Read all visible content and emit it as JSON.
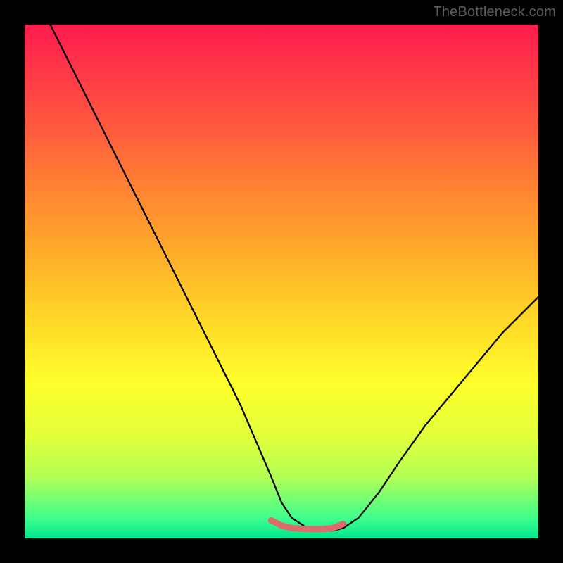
{
  "watermark": "TheBottleneck.com",
  "chart_data": {
    "type": "line",
    "title": "",
    "xlabel": "",
    "ylabel": "",
    "xlim": [
      0,
      100
    ],
    "ylim": [
      0,
      100
    ],
    "grid": false,
    "legend": false,
    "notes": "Unlabeled bottleneck curve over a vertical red→green gradient. No axes or tick labels are rendered. X/Y are read as percentages of the plot area (0–100). Lower y = closer to green band at bottom (better). The curve drops steeply from top-left, reaches a flat minimum near the bottom around x≈50–60, then rises toward the right edge (~45% height).",
    "series": [
      {
        "name": "curve",
        "stroke": "#000000",
        "x": [
          5,
          8,
          11,
          14,
          18,
          22,
          26,
          30,
          34,
          38,
          42,
          45,
          48,
          50,
          52,
          55,
          58,
          60,
          62,
          65,
          69,
          73,
          78,
          83,
          88,
          93,
          98,
          100
        ],
        "values": [
          100,
          94,
          88,
          82,
          74,
          66,
          58,
          50,
          42,
          34,
          26,
          19,
          12,
          7,
          4,
          2,
          1.5,
          1.5,
          2,
          4,
          9,
          15,
          22,
          28,
          34,
          40,
          45,
          47
        ]
      },
      {
        "name": "min-plateau-marker",
        "stroke": "#e06a6a",
        "x": [
          48,
          50,
          52,
          55,
          58,
          60,
          62
        ],
        "values": [
          3.5,
          2.5,
          2,
          1.8,
          1.8,
          2,
          2.8
        ]
      }
    ]
  }
}
